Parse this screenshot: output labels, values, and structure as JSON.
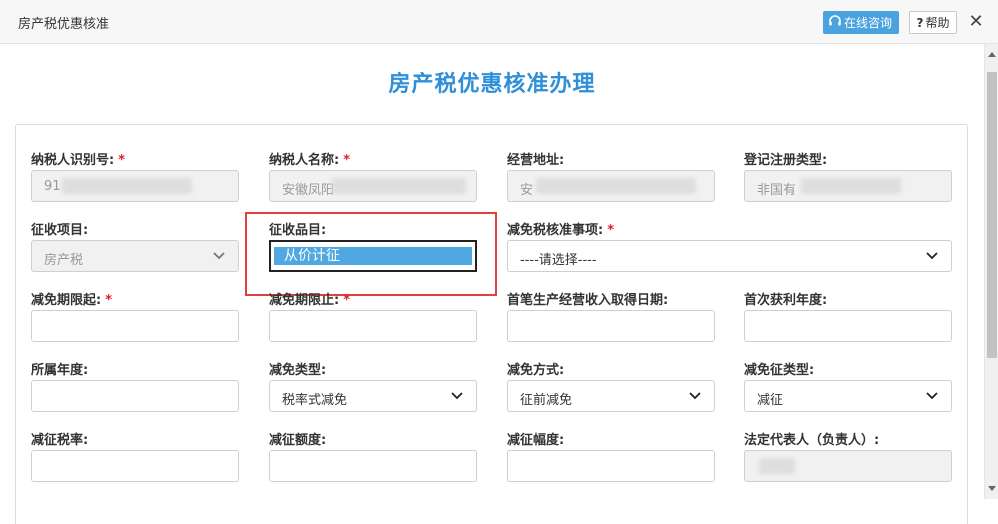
{
  "window": {
    "title": "房产税优惠核准",
    "consult_label": "在线咨询",
    "help_label": "帮助",
    "close_glyph": "✕"
  },
  "page_title": "房产税优惠核准办理",
  "colors": {
    "accent": "#2f8fd8",
    "consult_button": "#4aa3df",
    "required": "#e02020",
    "highlight": "#e04040",
    "selected_option": "#4fa9e0"
  },
  "fields": {
    "taxpayer_id": {
      "label": "纳税人识别号:",
      "value": "91"
    },
    "taxpayer_name": {
      "label": "纳税人名称:",
      "value": "安徽凤阳"
    },
    "business_address": {
      "label": "经营地址:",
      "value": "安"
    },
    "registration_type": {
      "label": "登记注册类型:",
      "value": "非国有"
    },
    "levy_item": {
      "label": "征收项目:",
      "value": "房产税"
    },
    "levy_subitem": {
      "label": "征收品目:",
      "value": "从价计征"
    },
    "exemption_item": {
      "label": "减免税核准事项:",
      "value": "----请选择----"
    },
    "exemption_start": {
      "label": "减免期限起:",
      "value": ""
    },
    "exemption_end": {
      "label": "减免期限止:",
      "value": ""
    },
    "first_income_date": {
      "label": "首笔生产经营收入取得日期:",
      "value": ""
    },
    "first_profit_year": {
      "label": "首次获利年度:",
      "value": ""
    },
    "belong_year": {
      "label": "所属年度:",
      "value": ""
    },
    "exemption_type": {
      "label": "减免类型:",
      "value": "税率式减免"
    },
    "exemption_method": {
      "label": "减免方式:",
      "value": "征前减免"
    },
    "levy_type": {
      "label": "减免征类型:",
      "value": "减征"
    },
    "reduced_rate": {
      "label": "减征税率:",
      "value": ""
    },
    "reduced_amount": {
      "label": "减征额度:",
      "value": ""
    },
    "reduced_range": {
      "label": "减征幅度:",
      "value": ""
    },
    "legal_rep": {
      "label": "法定代表人（负责人）:",
      "value": ""
    }
  }
}
